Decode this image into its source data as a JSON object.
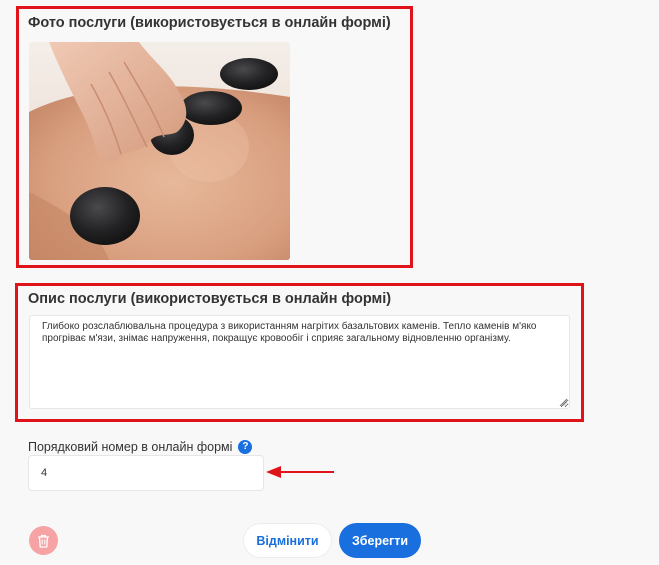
{
  "photo_section": {
    "title": "Фото послуги (використовується в онлайн формі)"
  },
  "description_section": {
    "title": "Опис послуги (використовується в онлайн формі)",
    "text": "Глибоко розслаблювальна процедура з використанням нагрітих базальтових каменів. Тепло каменів м'яко прогріває м'язи, знімає напруження, покращує кровообіг і сприяє загальному відновленню організму."
  },
  "order": {
    "label": "Порядковий номер в онлайн формі",
    "help_icon": "?",
    "value": "4"
  },
  "actions": {
    "cancel_label": "Відмінити",
    "save_label": "Зберегти"
  },
  "colors": {
    "highlight_border": "#e0121a",
    "primary": "#1a6fdf",
    "delete_bg": "#f5a3a5"
  }
}
